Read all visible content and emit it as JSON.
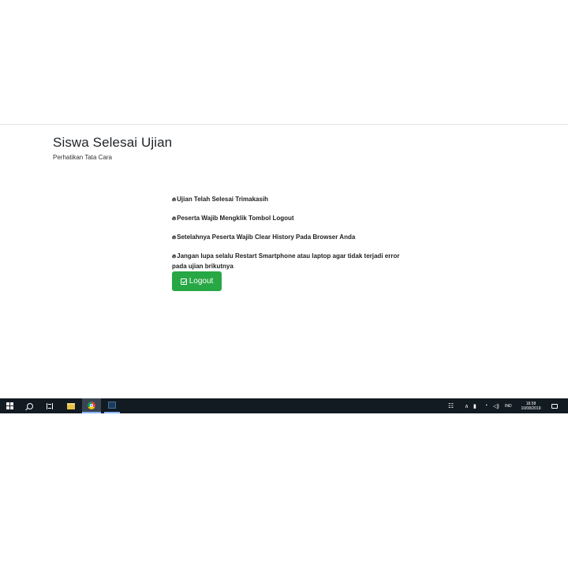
{
  "page": {
    "title": "Siswa Selesai Ujian",
    "subtitle": "Perhatikan Tata Cara"
  },
  "instructions": [
    "Ujian Telah Selesai Trimakasih",
    "Peserta Wajib Mengklik Tombol Logout",
    "Setelahnya Peserta Wajib Clear History Pada Browser Anda",
    "Jangan lupa selalu Restart Smartphone atau laptop agar tidak terjadi error pada ujian brikutnya"
  ],
  "bullet_icon": "fire-icon",
  "logout": {
    "label": "Logout",
    "icon": "check-square-icon",
    "color": "#28a745"
  },
  "taskbar": {
    "background": "#121a22",
    "apps": [
      "start-icon",
      "search-icon",
      "task-view-icon",
      "file-explorer-icon",
      "chrome-icon",
      "app-icon"
    ],
    "language": "IND",
    "time": "18.58",
    "date": "10/08/2019"
  }
}
